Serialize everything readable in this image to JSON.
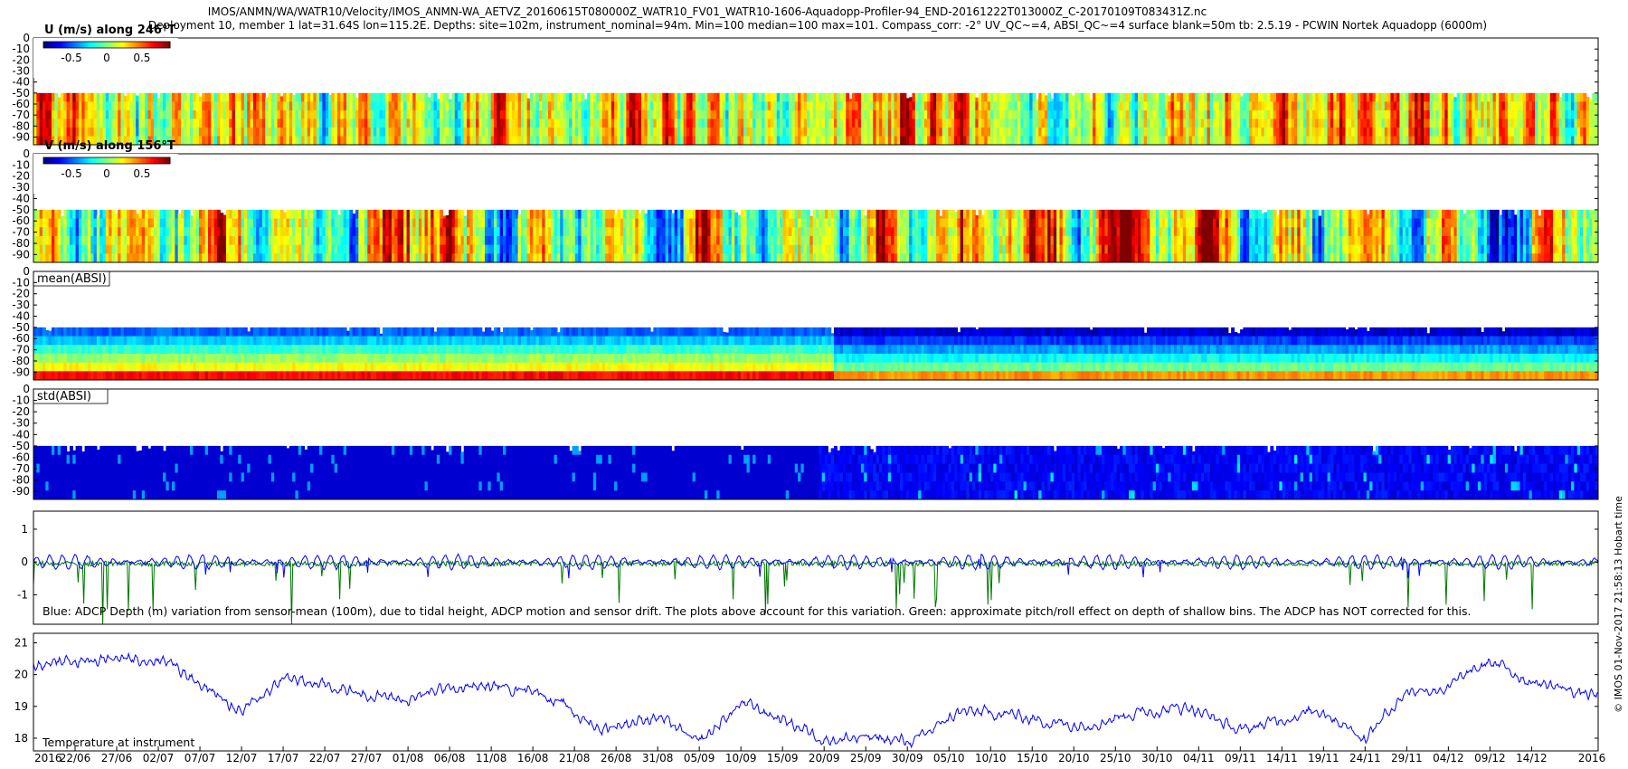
{
  "title_lines": [
    "IMOS/ANMN/WA/WATR10/Velocity/IMOS_ANMN-WA_AETVZ_20160615T080000Z_WATR10_FV01_WATR10-1606-Aquadopp-Profiler-94_END-20161222T013000Z_C-20170109T083431Z.nc",
    "Deployment 10, member 1 lat=31.64S lon=115.2E. Depths: site=102m, instrument_nominal=94m. Min=100 median=100 max=101. Compass_corr: -2° UV_QC~=4, ABSI_QC~=4 surface blank=50m tb: 2.5.19 - PCWIN Nortek Aquadopp  (6000m)"
  ],
  "side_text": "© IMOS 01-Nov-2017 21:58:13 Hobart time",
  "x_axis": {
    "year_left": "2016",
    "year_right": "2016",
    "ticks": [
      "22/06",
      "27/06",
      "02/07",
      "07/07",
      "12/07",
      "17/07",
      "22/07",
      "27/07",
      "01/08",
      "06/08",
      "11/08",
      "16/08",
      "21/08",
      "26/08",
      "31/08",
      "05/09",
      "10/09",
      "15/09",
      "20/09",
      "25/09",
      "30/09",
      "05/10",
      "10/10",
      "15/10",
      "20/10",
      "25/10",
      "30/10",
      "04/11",
      "09/11",
      "14/11",
      "19/11",
      "24/11",
      "29/11",
      "04/12",
      "09/12",
      "14/12"
    ]
  },
  "colors": {
    "adcp_depth": "#0000ff",
    "pitch_roll": "#007700",
    "temperature": "#0000ff"
  },
  "chart_data": [
    {
      "type": "heatmap",
      "label": "U (m/s) along 246°T",
      "y_ticks": [
        "0",
        "-10",
        "-20",
        "-30",
        "-40",
        "-50",
        "-60",
        "-70",
        "-80",
        "-90"
      ],
      "ylim": [
        -97,
        0
      ],
      "data_depth_range": [
        -97,
        -50
      ],
      "colorbar": {
        "ticks": [
          "-0.5",
          "0",
          "0.5"
        ],
        "range": [
          -0.9,
          0.9
        ]
      }
    },
    {
      "type": "heatmap",
      "label": "V (m/s) along 156°T",
      "y_ticks": [
        "0",
        "-10",
        "-20",
        "-30",
        "-40",
        "-50",
        "-60",
        "-70",
        "-80",
        "-90"
      ],
      "ylim": [
        -97,
        0
      ],
      "data_depth_range": [
        -97,
        -50
      ],
      "colorbar": {
        "ticks": [
          "-0.5",
          "0",
          "0.5"
        ],
        "range": [
          -0.9,
          0.9
        ]
      }
    },
    {
      "type": "heatmap",
      "label": "mean(ABSI)",
      "y_ticks": [
        "0",
        "-10",
        "-20",
        "-30",
        "-40",
        "-50",
        "-60",
        "-70",
        "-80",
        "-90"
      ],
      "ylim": [
        -97,
        0
      ],
      "data_depth_range": [
        -97,
        -50
      ]
    },
    {
      "type": "heatmap",
      "label": "std(ABSI)",
      "y_ticks": [
        "0",
        "-10",
        "-20",
        "-30",
        "-40",
        "-50",
        "-60",
        "-70",
        "-80",
        "-90"
      ],
      "ylim": [
        -97,
        0
      ],
      "data_depth_range": [
        -97,
        -50
      ]
    },
    {
      "type": "line",
      "annotation": "Blue: ADCP Depth (m) variation from sensor-mean (100m), due to tidal height, ADCP motion and sensor drift. The plots above account for this variation. Green: approximate pitch/roll effect on depth of shallow bins. The ADCP has NOT corrected for this.",
      "y_ticks": [
        "1",
        "0",
        "-1"
      ],
      "ylim": [
        -1.9,
        1.55
      ],
      "series": [
        {
          "amplitude": 0.22,
          "baseline": 0.0
        },
        {
          "baseline": -0.05,
          "min": -1.9
        }
      ]
    },
    {
      "type": "line",
      "annotation": "Temperature at instrument",
      "y_ticks": [
        "21",
        "20",
        "19",
        "18"
      ],
      "ylim": [
        17.6,
        21.3
      ],
      "x": [
        "2016-06-15",
        "2016-06-27",
        "2016-07-03",
        "2016-07-12",
        "2016-07-17",
        "2016-07-27",
        "2016-08-01",
        "2016-08-06",
        "2016-08-16",
        "2016-08-24",
        "2016-08-31",
        "2016-09-05",
        "2016-09-10",
        "2016-09-15",
        "2016-09-20",
        "2016-09-25",
        "2016-10-01",
        "2016-10-06",
        "2016-10-11",
        "2016-10-20",
        "2016-10-27",
        "2016-11-03",
        "2016-11-09",
        "2016-11-15",
        "2016-11-19",
        "2016-11-24",
        "2016-11-29",
        "2016-12-04",
        "2016-12-09",
        "2016-12-14",
        "2016-12-22"
      ],
      "values": [
        20.3,
        20.5,
        20.5,
        18.8,
        19.9,
        19.4,
        19.2,
        19.6,
        19.6,
        18.3,
        18.7,
        17.8,
        19.1,
        18.6,
        18.0,
        18.0,
        17.9,
        18.8,
        18.8,
        18.4,
        18.8,
        19.0,
        18.2,
        18.7,
        18.9,
        18.0,
        19.5,
        19.6,
        20.4,
        19.8,
        19.3
      ]
    }
  ]
}
